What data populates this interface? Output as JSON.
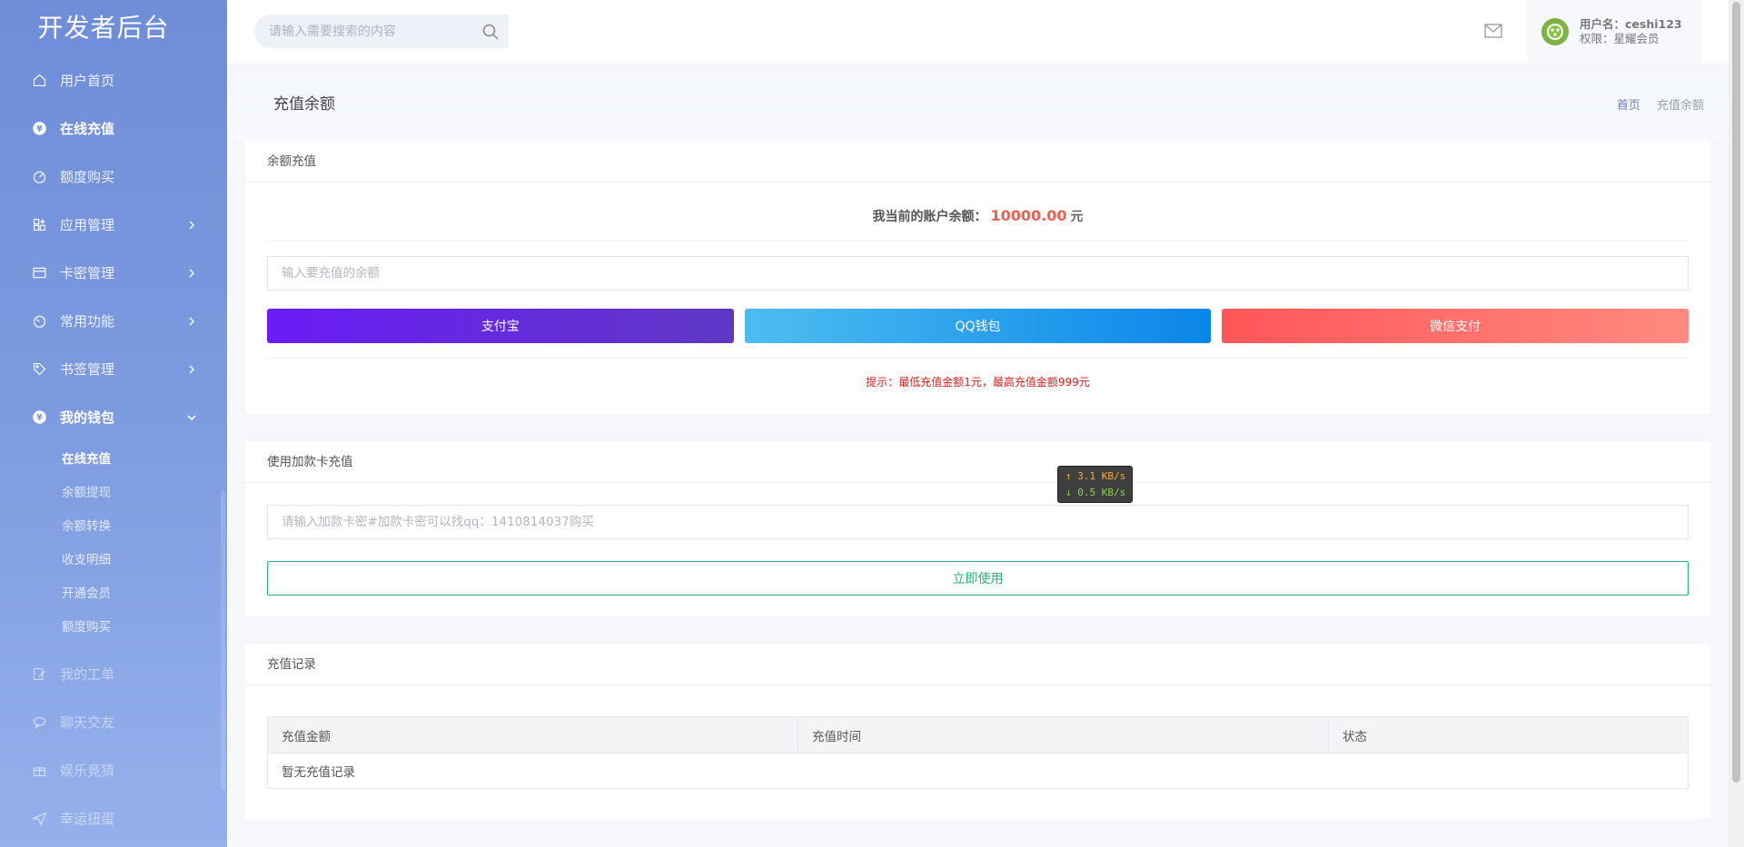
{
  "sidebar": {
    "logo": "开发者后台",
    "items": [
      {
        "label": "用户首页"
      },
      {
        "label": "在线充值"
      },
      {
        "label": "额度购买"
      },
      {
        "label": "应用管理"
      },
      {
        "label": "卡密管理"
      },
      {
        "label": "常用功能"
      },
      {
        "label": "书签管理"
      },
      {
        "label": "我的钱包"
      },
      {
        "label": "我的工单"
      },
      {
        "label": "聊天交友"
      },
      {
        "label": "娱乐竞猜"
      },
      {
        "label": "幸运扭蛋"
      }
    ],
    "wallet_sub": [
      "在线充值",
      "余额提现",
      "余额转换",
      "收支明细",
      "开通会员",
      "额度购买"
    ]
  },
  "header": {
    "search_placeholder": "请输入需要搜索的内容",
    "user_name_label": "用户名：ceshi123",
    "user_role_label": "权限：星耀会员"
  },
  "page": {
    "title": "充值余额",
    "breadcrumb_home": "首页",
    "breadcrumb_current": "充值余额"
  },
  "recharge": {
    "card_title": "余额充值",
    "balance_label": "我当前的账户余额：",
    "balance_value": "10000.00",
    "balance_unit": "元",
    "amount_placeholder": "输入要充值的余额",
    "alipay_label": "支付宝",
    "qq_label": "QQ钱包",
    "wechat_label": "微信支付",
    "tip": "提示：最低充值金额1元，最高充值金额999元"
  },
  "card_use": {
    "card_title": "使用加款卡充值",
    "placeholder": "请输入加款卡密#加款卡密可以找qq：1410814037购买",
    "button_label": "立即使用"
  },
  "records": {
    "card_title": "充值记录",
    "columns": [
      "充值金额",
      "充值时间",
      "状态"
    ],
    "empty_text": "暂无充值记录"
  },
  "speed": {
    "up": "↑ 3.1 KB/s",
    "down": "↓ 0.5 KB/s"
  },
  "colors": {
    "balance": "#f15f4c",
    "tip": "#d9201b",
    "use_button": "#26b07a"
  }
}
